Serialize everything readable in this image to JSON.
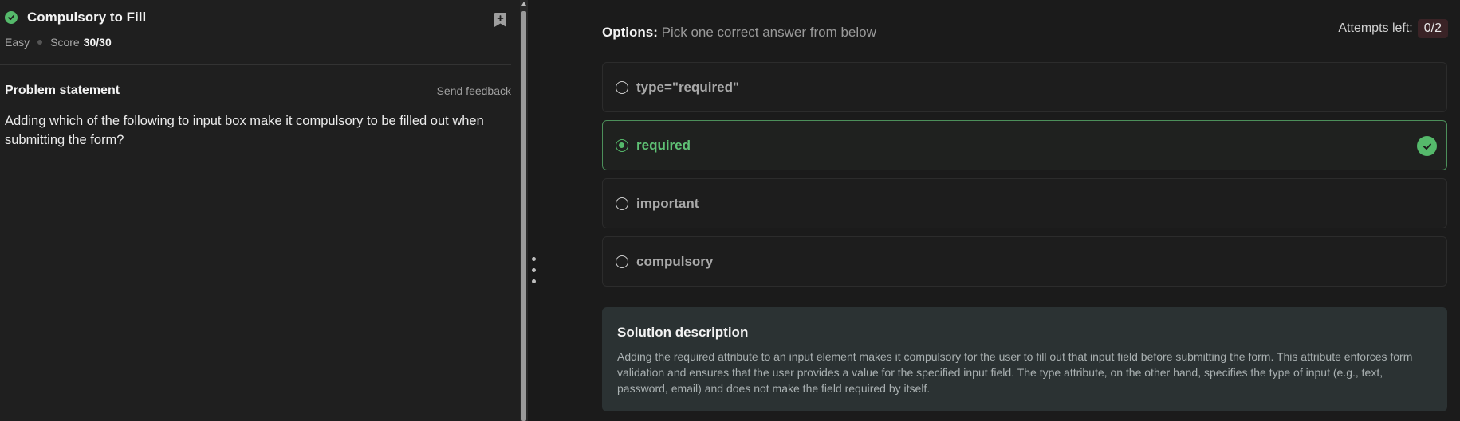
{
  "problem": {
    "title": "Compulsory to Fill",
    "difficulty": "Easy",
    "score_label": "Score",
    "score_value": "30/30",
    "section_title": "Problem statement",
    "send_feedback": "Send feedback",
    "statement": "Adding which of the following to input box make it compulsory to be filled out when submitting the form?"
  },
  "options_panel": {
    "heading_bold": "Options:",
    "heading_rest": " Pick one correct answer from below",
    "attempts_label": "Attempts left:",
    "attempts_value": "0/2",
    "options": [
      {
        "label": "type=\"required\"",
        "state": "unselected"
      },
      {
        "label": "required",
        "state": "correct-selected"
      },
      {
        "label": "important",
        "state": "unselected"
      },
      {
        "label": "compulsory",
        "state": "unselected"
      }
    ]
  },
  "solution": {
    "title": "Solution description",
    "text": "Adding the required attribute to an input element makes it compulsory for the user to fill out that input field before submitting the form. This attribute enforces form validation and ensures that the user provides a value for the specified input field. The type attribute, on the other hand, specifies the type of input (e.g., text, password, email) and does not make the field required by itself."
  },
  "colors": {
    "accent_green": "#55b96b",
    "badge_bg": "#3a2326",
    "solution_bg": "#2b3233"
  },
  "icons": [
    "check-circle-icon",
    "bookmark-add-icon",
    "radio-icon",
    "correct-check-icon",
    "drag-handle-icon"
  ]
}
